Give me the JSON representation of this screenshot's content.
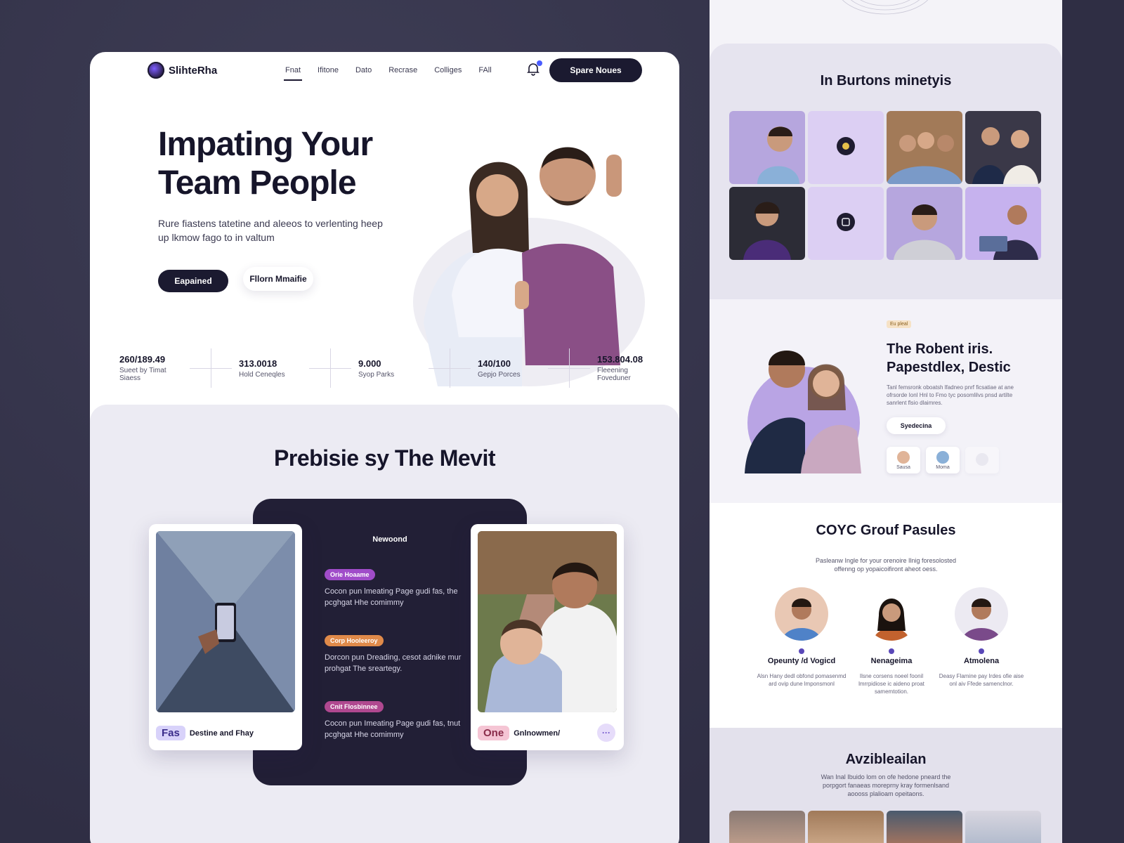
{
  "brand": {
    "name": "SlihteRha"
  },
  "nav": {
    "links": [
      "Fnat",
      "Ifitone",
      "Dato",
      "Recrase",
      "Colliges",
      "FAll"
    ],
    "cta": "Spare Noues"
  },
  "hero": {
    "title_line1": "Impating  Your",
    "title_line2": "Team People",
    "subtitle": "Rure fiastens tatetine and aleeos to verlenting heep up lkmow fago to in valtum",
    "primary_button": "Eapained",
    "secondary_button": "Fllorn Mmaifie"
  },
  "stats": [
    {
      "value": "260/189.49",
      "label": "Sueet by Timat Siaess"
    },
    {
      "value": "313.0018",
      "label": "Hold Ceneqles"
    },
    {
      "value": "9.000",
      "label": "Syop Parks"
    },
    {
      "value": "140/100",
      "label": "Gepjo Porces"
    },
    {
      "value": "153.804.08",
      "label": "Fleeening Foveduner"
    }
  ],
  "section2": {
    "title": "Prebisie sy The Mevit",
    "panel_label": "Newoond",
    "features": [
      {
        "pill": "Orie Hoaame",
        "text": "Cocon pun lmeating Page gudi fas, the pcghgat Hhe comimmy",
        "color": "#a04cc9"
      },
      {
        "pill": "Corp Hooleeroy",
        "text": "Dorcon pun Dreading, cesot adnike mur prohgat The sreartegy.",
        "color": "#e08a4a"
      },
      {
        "pill": "Cnit Flosbinnee",
        "text": "Cocon pun Imeating Page gudi fas, tnut pcghgat Hhe comimmy",
        "color": "#b04890"
      }
    ],
    "card_left": {
      "tag": "Fas",
      "caption": "Destine and Fhay"
    },
    "card_right": {
      "tag": "One",
      "caption": "Gnlnowmen/",
      "more": "···"
    }
  },
  "right": {
    "gallery_title": "In Burtons minetyis",
    "feature": {
      "badge": "Eu pleal",
      "title": "The Robent iris. Papestdlex, Destic",
      "text": "Tanl femsronk oboatsh lfadneo pnrf ficsatiae at ane ofrsorde Ionl Hnl to Fmo tyc posomlilvs pnsd artilte sanrlent flsio dlaimres.",
      "button": "Syedecina",
      "thumbs": [
        "Sausa",
        "Moma"
      ]
    },
    "team_title": "COYC Grouf Pasules",
    "team_sub": "Pasleanw Ingle for your orenoire Ilnig foresolosted offenng op yopaicoifiront aheot oess.",
    "team": [
      {
        "name": "Opeunty /d Vogicd",
        "text": "Alsn Hany dedl obfond pomasenmd ard ovip dune lmponsmonl"
      },
      {
        "name": "Nenageima",
        "text": "Ilsne corsens noeel foonil lmrrpidiose ic aideno proat samemtotion."
      },
      {
        "name": "Atmolena",
        "text": "Deasy Flamine pay Irdes ofie aise onl aiv Ffede samenclnor."
      }
    ],
    "bottom_title": "Avzibleailan",
    "bottom_sub": "Wan Inal Ibuido lom on ofe hedone pneard the porpgort fanaeas moreprny kray formenlsand aoooss plalioam opeitaons."
  }
}
